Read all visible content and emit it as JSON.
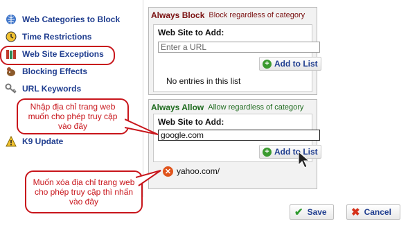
{
  "sidebar": {
    "items": [
      {
        "label": "Web Categories to Block",
        "icon": "globe-icon"
      },
      {
        "label": "Time Restrictions",
        "icon": "clock-icon"
      },
      {
        "label": "Web Site Exceptions",
        "icon": "books-icon"
      },
      {
        "label": "Blocking Effects",
        "icon": "dog-icon"
      },
      {
        "label": "URL Keywords",
        "icon": "keys-icon"
      },
      {
        "label": "K9 Update",
        "icon": "warning-icon"
      }
    ]
  },
  "always_block": {
    "title": "Always Block",
    "subtitle": "Block regardless of category",
    "field_label": "Web Site to Add:",
    "input_placeholder": "Enter a URL",
    "add_button": "Add to List",
    "empty_text": "No entries in this list"
  },
  "always_allow": {
    "title": "Always Allow",
    "subtitle": "Allow regardless of category",
    "field_label": "Web Site to Add:",
    "input_value": "google.com",
    "add_button": "Add to List",
    "entries": [
      "yahoo.com/"
    ]
  },
  "callouts": {
    "add_hint": "Nhập địa chỉ trang web muốn cho phép truy cập vào đây",
    "remove_hint": "Muốn xóa địa chỉ trang web cho phép truy cập thì nhấn vào đây"
  },
  "footer": {
    "save": "Save",
    "cancel": "Cancel"
  },
  "colors": {
    "accent_red": "#c8151b",
    "link_blue": "#1f3d8f",
    "block_title": "#7a1010",
    "allow_title": "#1e6b1e"
  }
}
